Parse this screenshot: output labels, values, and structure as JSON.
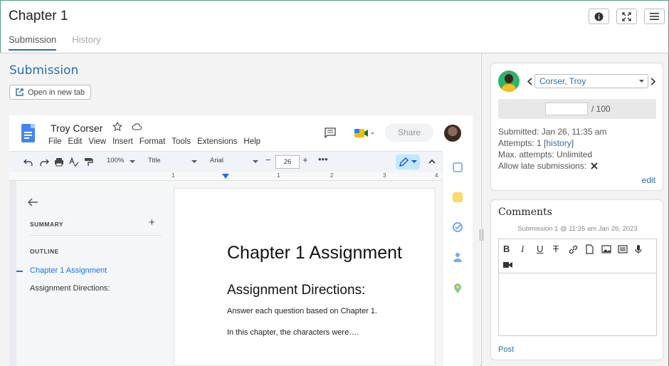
{
  "page": {
    "title": "Chapter 1"
  },
  "tabs": [
    {
      "label": "Submission"
    },
    {
      "label": "History"
    }
  ],
  "submission": {
    "heading": "Submission",
    "open_new_tab": "Open in new tab"
  },
  "doc": {
    "name": "Troy Corser",
    "menu": [
      "File",
      "Edit",
      "View",
      "Insert",
      "Format",
      "Tools",
      "Extensions",
      "Help"
    ],
    "share": "Share",
    "toolbar": {
      "zoom": "100%",
      "style": "Title",
      "font": "Arial",
      "size": "26"
    },
    "ruler": [
      "1",
      "1",
      "2",
      "3",
      "4"
    ],
    "outline": {
      "summary": "SUMMARY",
      "outline": "OUTLINE",
      "items": [
        "Chapter 1 Assignment",
        "Assignment Directions:"
      ]
    },
    "content": {
      "h1": "Chapter 1 Assignment",
      "h2": "Assignment Directions:",
      "p1": "Answer each question based on Chapter 1.",
      "p2": "In this chapter, the characters were…."
    }
  },
  "grading": {
    "student": "Corser, Troy",
    "grade_max": "/ 100",
    "submitted": "Submitted: Jan 26, 11:35 am",
    "attempts_prefix": "Attempts: 1 [",
    "attempts_link": "history",
    "attempts_suffix": "]",
    "max_attempts": "Max. attempts: Unlimited",
    "late": "Allow late submissions:",
    "edit": "edit"
  },
  "comments": {
    "title": "Comments",
    "subtitle": "Submission 1 @ 11:35 am Jan 26, 2023",
    "post": "Post"
  },
  "colors": {
    "accent": "#2a6fa8",
    "docs_blue": "#4285f4",
    "frame": "#5a9a8a"
  }
}
